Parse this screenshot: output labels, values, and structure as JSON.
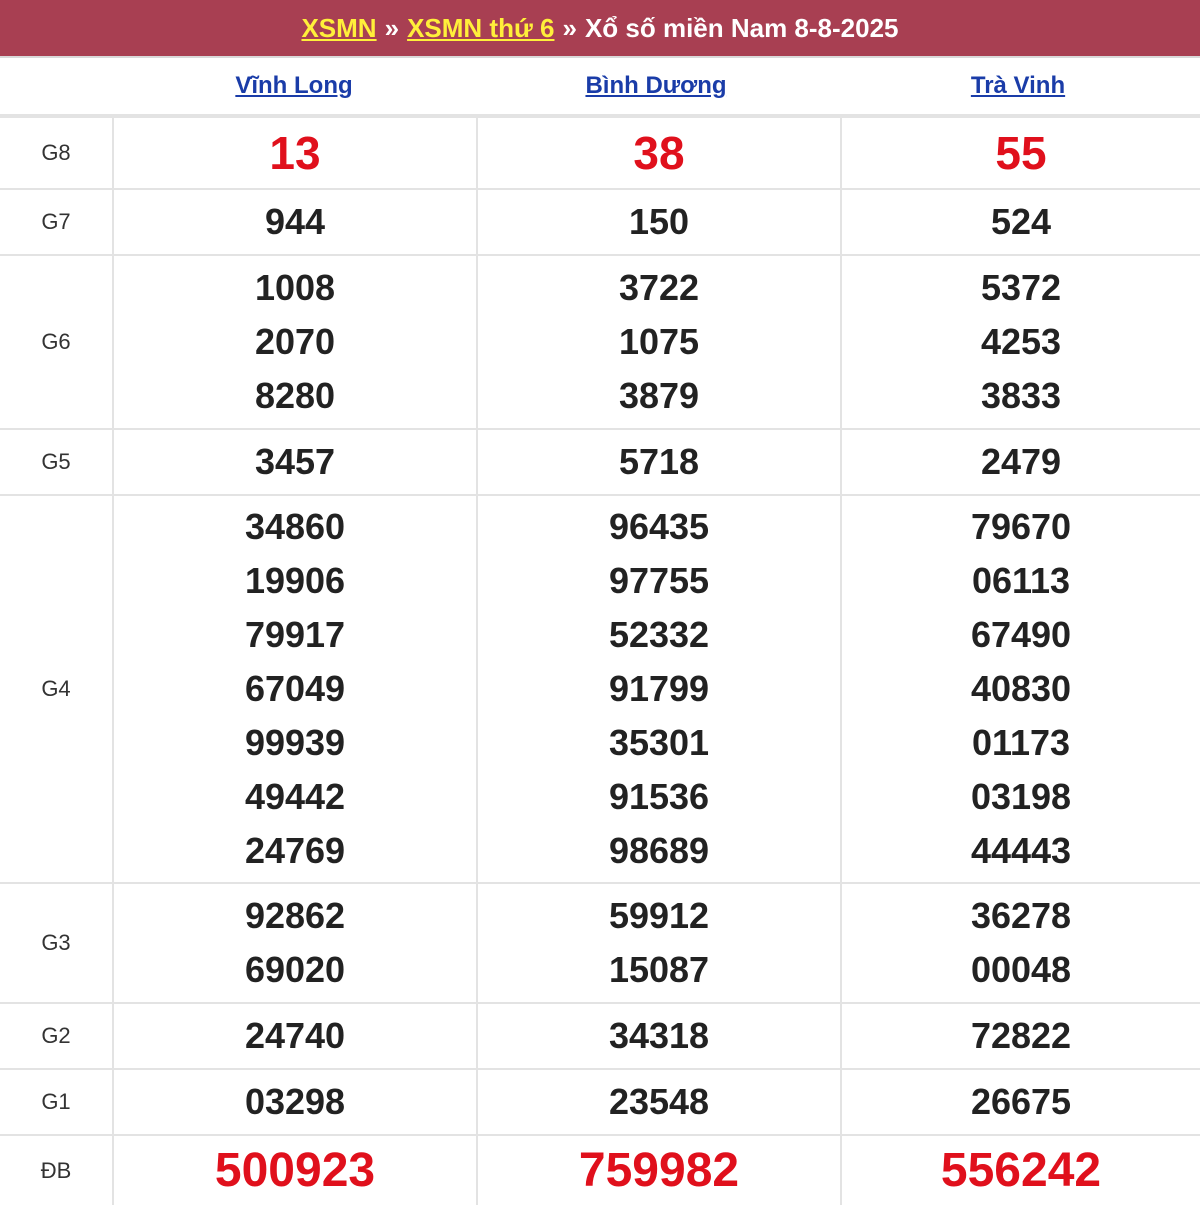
{
  "header": {
    "link1": "XSMN",
    "sep1": "»",
    "link2": "XSMN thứ 6",
    "sep2": "»",
    "title": "Xổ số miền Nam 8-8-2025"
  },
  "provinces": [
    "Vĩnh Long",
    "Bình Dương",
    "Trà Vinh"
  ],
  "colors": {
    "header_bg": "#a83f52",
    "link_yellow": "#ffef3a",
    "province_blue": "#1a3ca8",
    "prize_red": "#e0101c"
  },
  "prizes": [
    {
      "label": "G8",
      "values": [
        [
          "13"
        ],
        [
          "38"
        ],
        [
          "55"
        ]
      ]
    },
    {
      "label": "G7",
      "values": [
        [
          "944"
        ],
        [
          "150"
        ],
        [
          "524"
        ]
      ]
    },
    {
      "label": "G6",
      "values": [
        [
          "1008",
          "2070",
          "8280"
        ],
        [
          "3722",
          "1075",
          "3879"
        ],
        [
          "5372",
          "4253",
          "3833"
        ]
      ]
    },
    {
      "label": "G5",
      "values": [
        [
          "3457"
        ],
        [
          "5718"
        ],
        [
          "2479"
        ]
      ]
    },
    {
      "label": "G4",
      "values": [
        [
          "34860",
          "19906",
          "79917",
          "67049",
          "99939",
          "49442",
          "24769"
        ],
        [
          "96435",
          "97755",
          "52332",
          "91799",
          "35301",
          "91536",
          "98689"
        ],
        [
          "79670",
          "06113",
          "67490",
          "40830",
          "01173",
          "03198",
          "44443"
        ]
      ]
    },
    {
      "label": "G3",
      "values": [
        [
          "92862",
          "69020"
        ],
        [
          "59912",
          "15087"
        ],
        [
          "36278",
          "00048"
        ]
      ]
    },
    {
      "label": "G2",
      "values": [
        [
          "24740"
        ],
        [
          "34318"
        ],
        [
          "72822"
        ]
      ]
    },
    {
      "label": "G1",
      "values": [
        [
          "03298"
        ],
        [
          "23548"
        ],
        [
          "26675"
        ]
      ]
    },
    {
      "label": "ĐB",
      "values": [
        [
          "500923"
        ],
        [
          "759982"
        ],
        [
          "556242"
        ]
      ]
    }
  ]
}
